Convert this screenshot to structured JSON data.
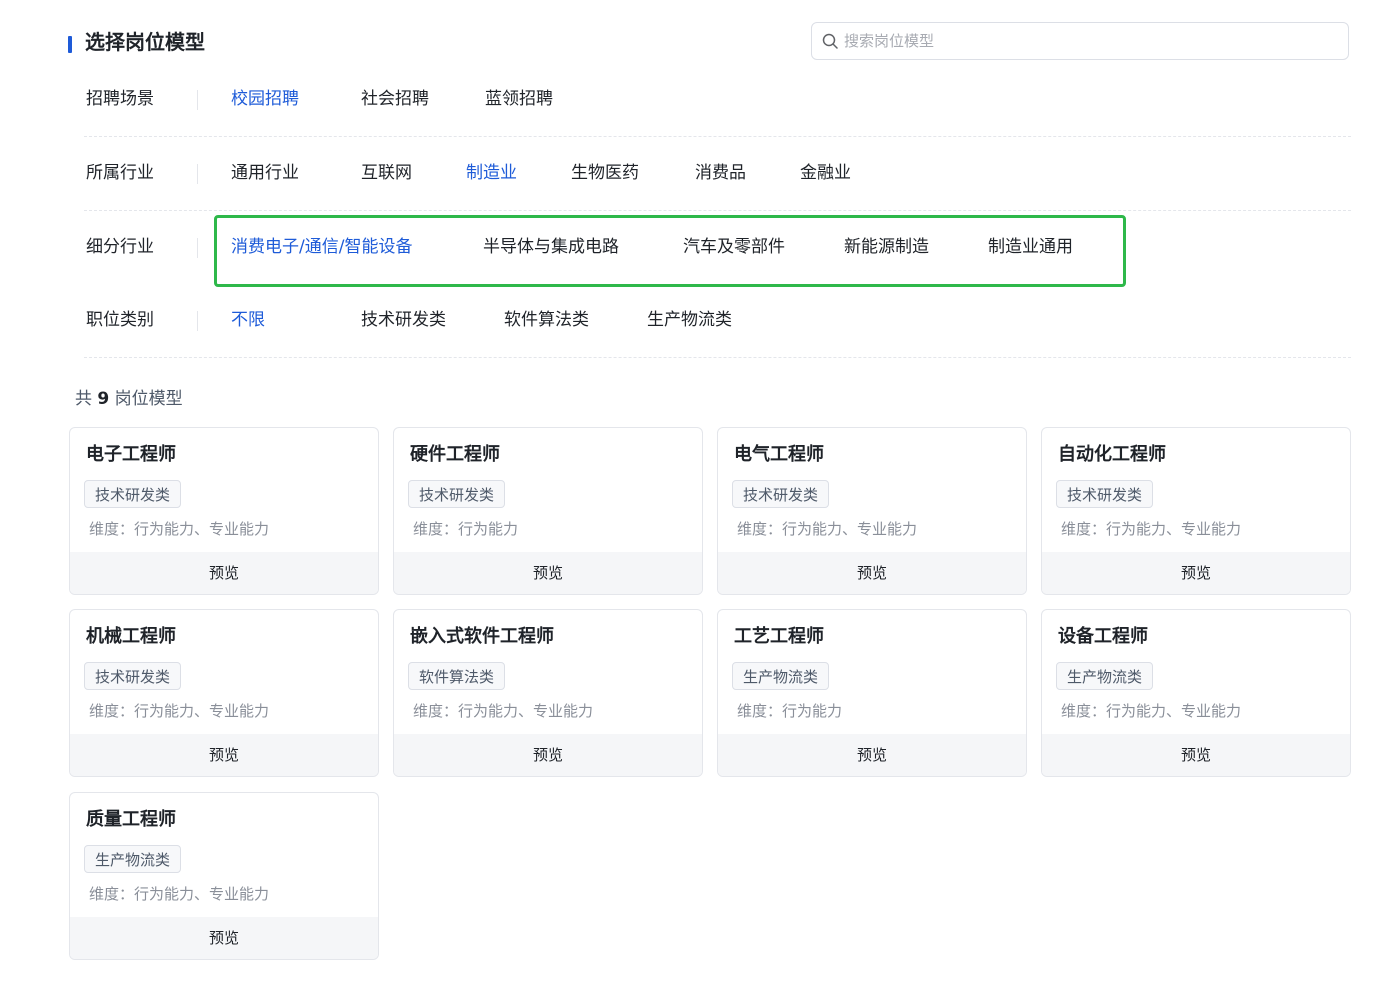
{
  "header": {
    "title": "选择岗位模型",
    "search_placeholder": "搜索岗位模型"
  },
  "filters": [
    {
      "label": "招聘场景",
      "options": [
        "校园招聘",
        "社会招聘",
        "蓝领招聘"
      ],
      "active": "校园招聘"
    },
    {
      "label": "所属行业",
      "options": [
        "通用行业",
        "互联网",
        "制造业",
        "生物医药",
        "消费品",
        "金融业"
      ],
      "active": "制造业"
    },
    {
      "label": "细分行业",
      "options": [
        "消费电子/通信/智能设备",
        "半导体与集成电路",
        "汽车及零部件",
        "新能源制造",
        "制造业通用"
      ],
      "active": "消费电子/通信/智能设备"
    },
    {
      "label": "职位类别",
      "options": [
        "不限",
        "技术研发类",
        "软件算法类",
        "生产物流类"
      ],
      "active": "不限"
    }
  ],
  "result": {
    "prefix": "共",
    "count": "9",
    "suffix": "岗位模型"
  },
  "cards": [
    {
      "title": "电子工程师",
      "tag": "技术研发类",
      "dims": "维度：行为能力、专业能力",
      "action": "预览"
    },
    {
      "title": "硬件工程师",
      "tag": "技术研发类",
      "dims": "维度：行为能力",
      "action": "预览"
    },
    {
      "title": "电气工程师",
      "tag": "技术研发类",
      "dims": "维度：行为能力、专业能力",
      "action": "预览"
    },
    {
      "title": "自动化工程师",
      "tag": "技术研发类",
      "dims": "维度：行为能力、专业能力",
      "action": "预览"
    },
    {
      "title": "机械工程师",
      "tag": "技术研发类",
      "dims": "维度：行为能力、专业能力",
      "action": "预览"
    },
    {
      "title": "嵌入式软件工程师",
      "tag": "软件算法类",
      "dims": "维度：行为能力、专业能力",
      "action": "预览"
    },
    {
      "title": "工艺工程师",
      "tag": "生产物流类",
      "dims": "维度：行为能力",
      "action": "预览"
    },
    {
      "title": "设备工程师",
      "tag": "生产物流类",
      "dims": "维度：行为能力、专业能力",
      "action": "预览"
    },
    {
      "title": "质量工程师",
      "tag": "生产物流类",
      "dims": "维度：行为能力、专业能力",
      "action": "预览"
    }
  ],
  "colors": {
    "accent": "#1e5bd8",
    "highlight": "#2eb84a"
  }
}
